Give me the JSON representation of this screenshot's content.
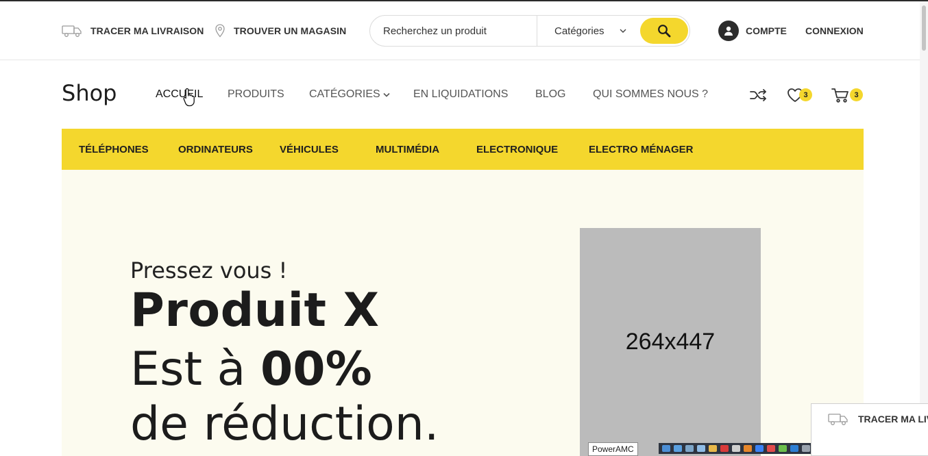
{
  "topbar": {
    "track_label": "TRACER MA LIVRAISON",
    "store_label": "TROUVER UN MAGASIN",
    "search_placeholder": "Recherchez un produit",
    "search_category": "Catégories",
    "account_label": "COMPTE",
    "login_label": "CONNEXION"
  },
  "header": {
    "logo": "Shop",
    "nav": [
      {
        "label": "ACCUEIL"
      },
      {
        "label": "PRODUITS"
      },
      {
        "label": "CATÉGORIES"
      },
      {
        "label": "EN LIQUIDATIONS"
      },
      {
        "label": "BLOG"
      },
      {
        "label": "QUI SOMMES NOUS ?"
      }
    ],
    "wishlist_count": "3",
    "cart_count": "3"
  },
  "category_bar": {
    "items": [
      {
        "label": "TÉLÉPHONES"
      },
      {
        "label": "ORDINATEURS"
      },
      {
        "label": "VÉHICULES"
      },
      {
        "label": "MULTIMÉDIA"
      },
      {
        "label": "ELECTRONIQUE"
      },
      {
        "label": "ELECTRO MÉNAGER"
      }
    ]
  },
  "hero": {
    "kicker": "Pressez vous !",
    "title": "Produit X",
    "line2_prefix": "Est à ",
    "line2_value": "00%",
    "line3": "de réduction.",
    "image_placeholder": "264x447"
  },
  "overlay": {
    "tooltip": "PowerAMC",
    "ghost_label": "TRACER MA LIVRAISON"
  },
  "colors": {
    "accent": "#f4d72d",
    "hero_bg": "#fcfbef",
    "placeholder_bg": "#bbbbbb"
  }
}
